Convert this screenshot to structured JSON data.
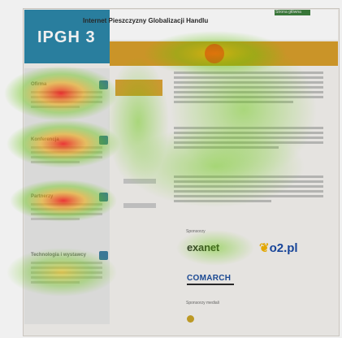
{
  "site": {
    "logo_text": "IPGH 3",
    "title": "Internet Pieszczyzny Globalizacji Handlu",
    "top_pill": "Strona główna"
  },
  "left_sections": [
    {
      "title": "Ofirma"
    },
    {
      "title": "Konferencja"
    },
    {
      "title": "Partnerzy"
    },
    {
      "title": "Technologia i wystawcy"
    }
  ],
  "sponsors": {
    "label": "Sponsorzy"
  },
  "partners_label": "Sponsorzy mediali",
  "brands": {
    "exanet": "exanet",
    "o2": "o2.pl",
    "comarch": "COMARCH"
  },
  "colors": {
    "accent_orange": "#d79e2b",
    "logo_blue": "#2c86a8",
    "page_bg": "#f4f2ee"
  }
}
